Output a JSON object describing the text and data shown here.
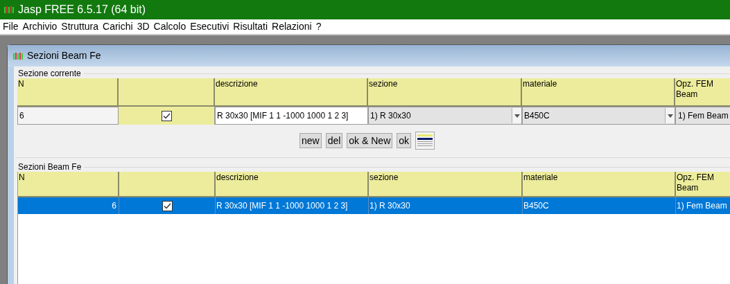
{
  "app": {
    "title": "Jasp FREE 6.5.17 (64 bit)"
  },
  "menu": [
    "File",
    "Archivio",
    "Struttura",
    "Carichi",
    "3D",
    "Calcolo",
    "Esecutivi",
    "Risultati",
    "Relazioni",
    "?"
  ],
  "dialog": {
    "title": "Sezioni Beam Fe"
  },
  "current_section": {
    "label": "Sezione corrente",
    "columns": [
      {
        "kind": "text",
        "label": "N"
      },
      {
        "kind": "check"
      },
      {
        "kind": "text",
        "label": "descrizione"
      },
      {
        "kind": "text",
        "label": "sezione"
      },
      {
        "kind": "text",
        "label": "materiale"
      },
      {
        "kind": "text",
        "label": "Opz. FEM Beam"
      }
    ],
    "row": {
      "n": "6",
      "checked": true,
      "descrizione": "R 30x30 [MIF 1 1 -1000 1000 1 2 3]",
      "sezione": "1) R 30x30",
      "materiale": "B450C",
      "opz_fem": "1) Fem Beam"
    }
  },
  "buttons": [
    {
      "kind": "text",
      "label": "new"
    },
    {
      "kind": "text",
      "label": "del"
    },
    {
      "kind": "text",
      "label": "ok & New"
    },
    {
      "kind": "text",
      "label": "ok"
    },
    {
      "kind": "icon"
    }
  ],
  "list": {
    "label": "Sezioni Beam Fe",
    "columns": [
      {
        "kind": "text",
        "label": "N"
      },
      {
        "kind": "check"
      },
      {
        "kind": "text",
        "label": "descrizione"
      },
      {
        "kind": "text",
        "label": "sezione"
      },
      {
        "kind": "text",
        "label": "materiale"
      },
      {
        "kind": "text",
        "label": "Opz. FEM Beam"
      }
    ],
    "rows": [
      {
        "n": "6",
        "checked": true,
        "descrizione": "R 30x30 [MIF 1 1 -1000 1000 1 2 3]",
        "sezione": "1) R 30x30",
        "materiale": "B450C",
        "opz_fem": "1) Fem Beam",
        "selected": true
      }
    ]
  }
}
